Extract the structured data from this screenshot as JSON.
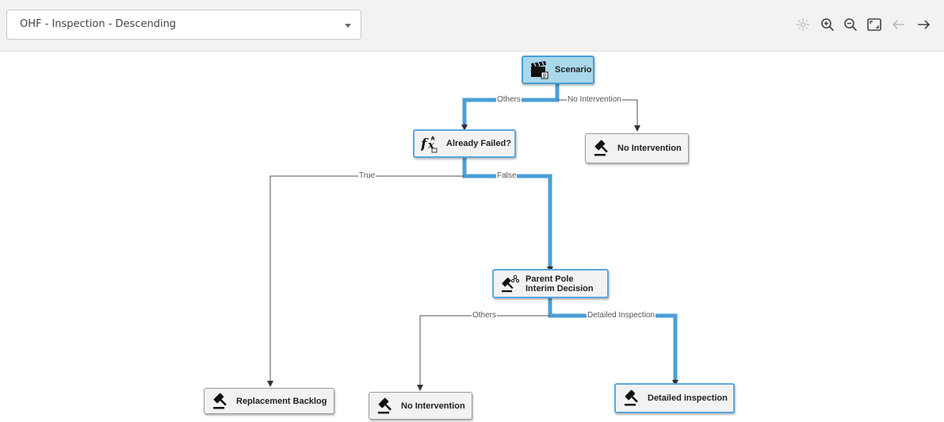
{
  "toolbar": {
    "scenario_select": {
      "value": "OHF - Inspection - Descending"
    },
    "icons": [
      "center-icon",
      "zoom-in-icon",
      "zoom-out-icon",
      "fit-view-icon",
      "arrow-left-icon",
      "arrow-right-icon"
    ]
  },
  "flow": {
    "highlight_color": "#4a9fd8",
    "nodes": {
      "scenario": {
        "label": "Scenario",
        "icon": "clapperboard-icon"
      },
      "already_failed": {
        "label": "Already Failed?",
        "icon": "function-icon"
      },
      "no_intervention_1": {
        "label": "No Intervention",
        "icon": "gavel-icon"
      },
      "parent_pole": {
        "label": "Parent Pole Interim Decision",
        "icon": "gavel-hierarchy-icon"
      },
      "replacement_backlog": {
        "label": "Replacement Backlog",
        "icon": "gavel-icon"
      },
      "no_intervention_2": {
        "label": "No Intervention",
        "icon": "gavel-icon"
      },
      "detailed_inspection": {
        "label": "Detailed inspection",
        "icon": "gavel-icon"
      }
    },
    "edge_labels": {
      "scenario_others": "Others",
      "scenario_no_intervention": "No Intervention",
      "failed_true": "True",
      "failed_false": "False",
      "parent_others": "Others",
      "parent_detailed": "Detailed Inspection"
    }
  }
}
